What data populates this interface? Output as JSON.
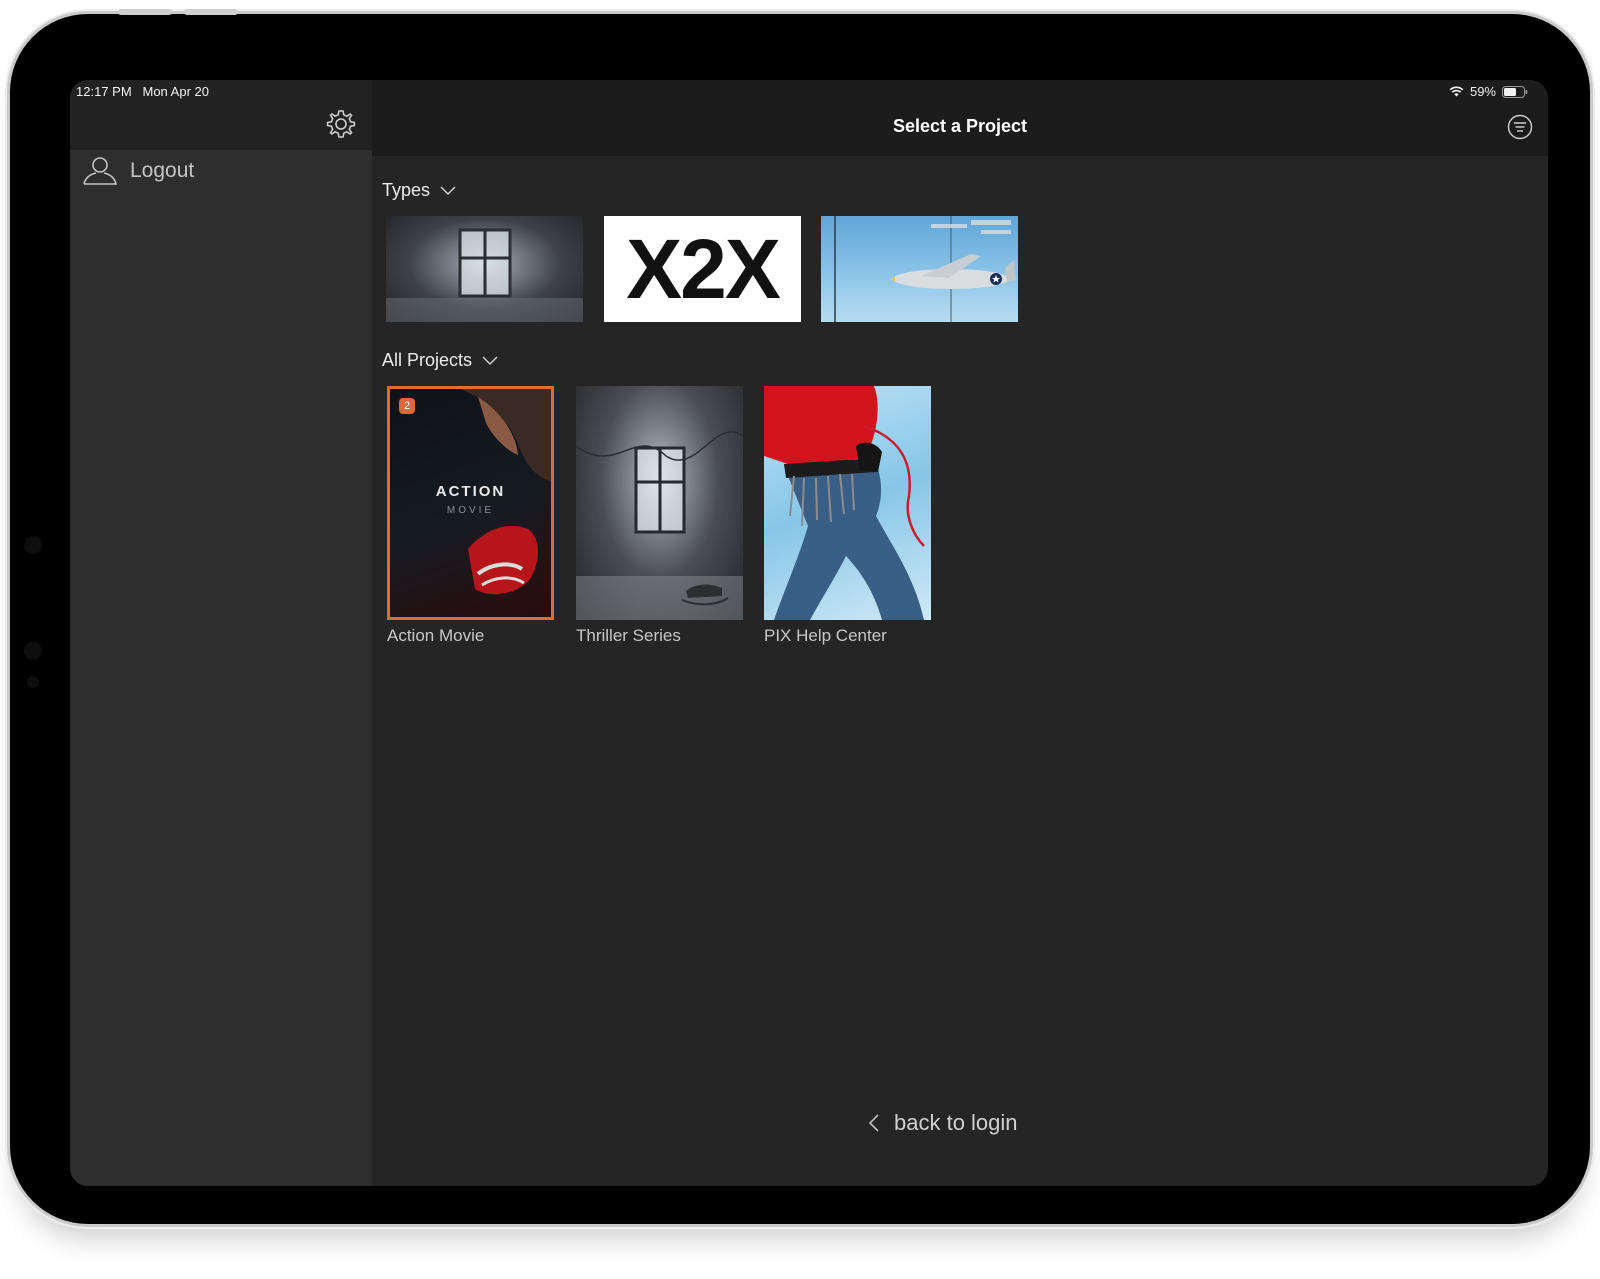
{
  "status_bar": {
    "time": "12:17 PM",
    "date": "Mon Apr 20",
    "battery": "59%",
    "icons": [
      "wifi-icon",
      "battery-icon"
    ]
  },
  "sidebar": {
    "settings_icon": "gear-icon",
    "logout_label": "Logout",
    "logout_icon": "user-icon"
  },
  "header": {
    "title": "Select a Project",
    "filter_icon": "filter-icon"
  },
  "types": {
    "label": "Types",
    "items": [
      {
        "name": "window-thumbnail"
      },
      {
        "name": "x2x-thumbnail",
        "text": "X2X"
      },
      {
        "name": "airplane-thumbnail"
      }
    ]
  },
  "projects": {
    "label": "All Projects",
    "items": [
      {
        "name": "Action Movie",
        "badge": "2",
        "poster_title": "ACTION",
        "poster_subtitle": "MOVIE",
        "selected": true
      },
      {
        "name": "Thriller Series"
      },
      {
        "name": "PIX Help Center"
      }
    ]
  },
  "footer": {
    "back_label": "back to login"
  },
  "colors": {
    "accent": "#e86a2a",
    "background": "#252525",
    "sidebar": "#2e2e2e"
  }
}
